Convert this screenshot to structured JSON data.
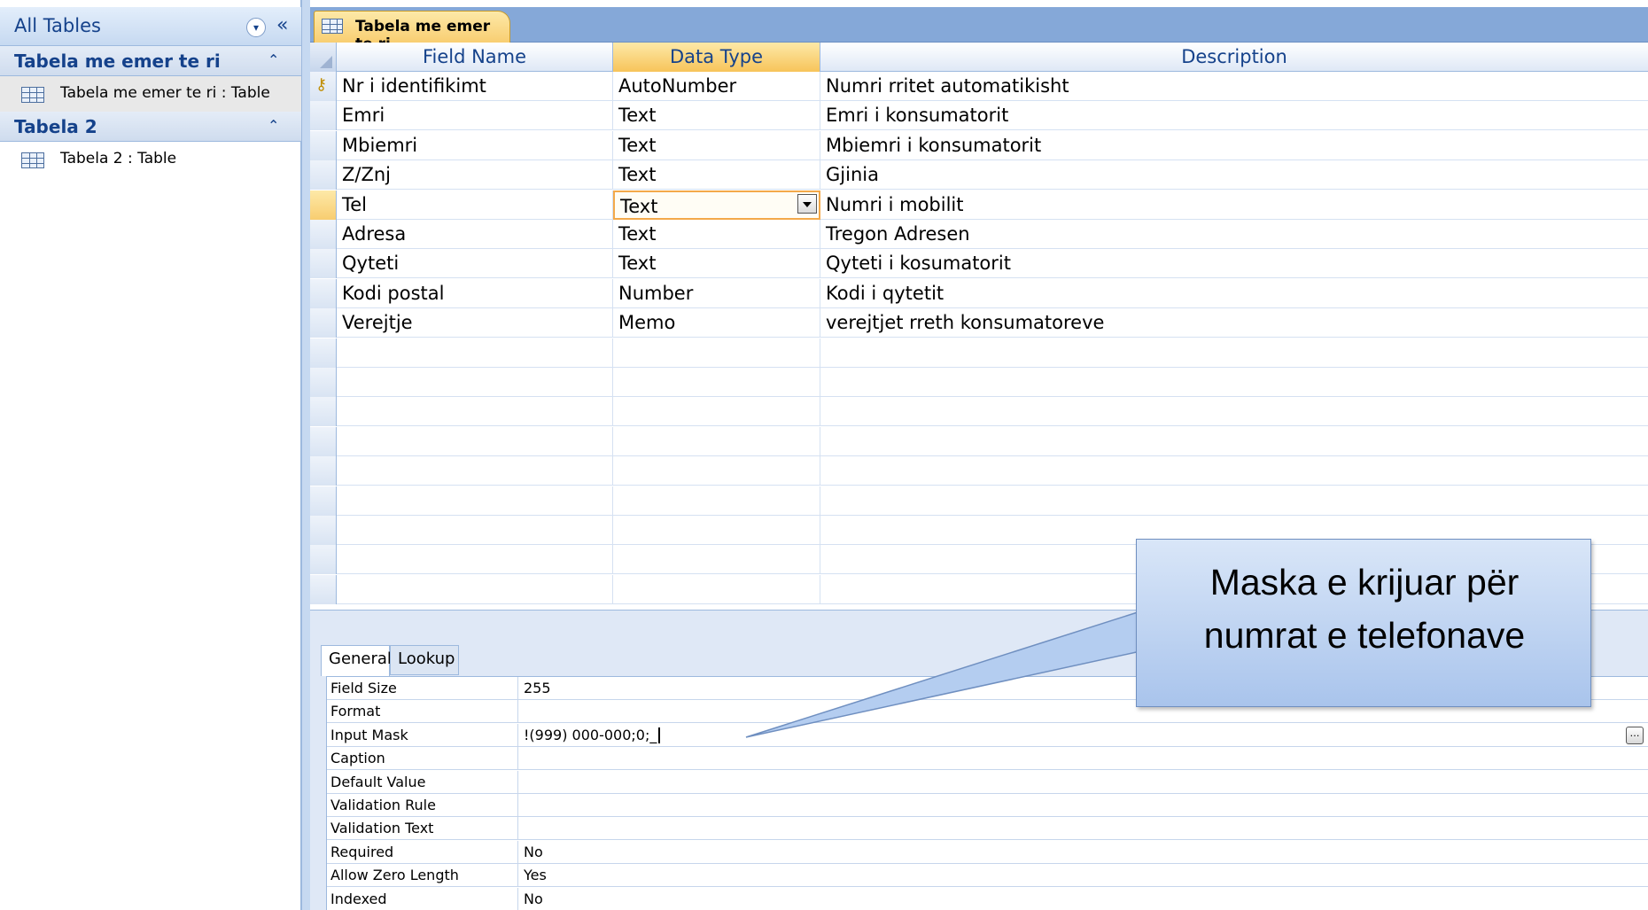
{
  "nav": {
    "title": "All Tables",
    "groups": [
      {
        "label": "Tabela me emer te ri",
        "items": [
          {
            "label": "Tabela me emer te ri : Table"
          }
        ]
      },
      {
        "label": "Tabela 2",
        "items": [
          {
            "label": "Tabela 2 : Table"
          }
        ]
      }
    ]
  },
  "document": {
    "tab_label": "Tabela me emer te ri",
    "columns": {
      "field_name": "Field Name",
      "data_type": "Data Type",
      "description": "Description"
    },
    "rows": [
      {
        "field": "Nr i identifikimt",
        "type": "AutoNumber",
        "desc": "Numri rritet automatikisht",
        "primary_key": true
      },
      {
        "field": "Emri",
        "type": "Text",
        "desc": "Emri i konsumatorit"
      },
      {
        "field": "Mbiemri",
        "type": "Text",
        "desc": "Mbiemri i konsumatorit"
      },
      {
        "field": "Z/Znj",
        "type": "Text",
        "desc": "Gjinia"
      },
      {
        "field": "Tel",
        "type": "Text",
        "desc": "Numri i mobilit",
        "current": true
      },
      {
        "field": "Adresa",
        "type": "Text",
        "desc": "Tregon Adresen"
      },
      {
        "field": "Qyteti",
        "type": "Text",
        "desc": "Qyteti i kosumatorit"
      },
      {
        "field": "Kodi postal",
        "type": "Number",
        "desc": "Kodi i qytetit"
      },
      {
        "field": "Verejtje",
        "type": "Memo",
        "desc": "verejtjet rreth konsumatoreve"
      }
    ]
  },
  "properties": {
    "tabs": [
      "General",
      "Lookup"
    ],
    "active_tab": "General",
    "rows": [
      {
        "name": "Field Size",
        "value": "255"
      },
      {
        "name": "Format",
        "value": ""
      },
      {
        "name": "Input Mask",
        "value": "!(999) 000-000;0;_"
      },
      {
        "name": "Caption",
        "value": ""
      },
      {
        "name": "Default Value",
        "value": ""
      },
      {
        "name": "Validation Rule",
        "value": ""
      },
      {
        "name": "Validation Text",
        "value": ""
      },
      {
        "name": "Required",
        "value": "No"
      },
      {
        "name": "Allow Zero Length",
        "value": "Yes"
      },
      {
        "name": "Indexed",
        "value": "No"
      }
    ]
  },
  "callout": {
    "text": "Maska e krijuar  për\nnumrat e  telefonave"
  },
  "colors": {
    "selected_tab": "#f8cd70",
    "nav_text": "#15428b"
  }
}
